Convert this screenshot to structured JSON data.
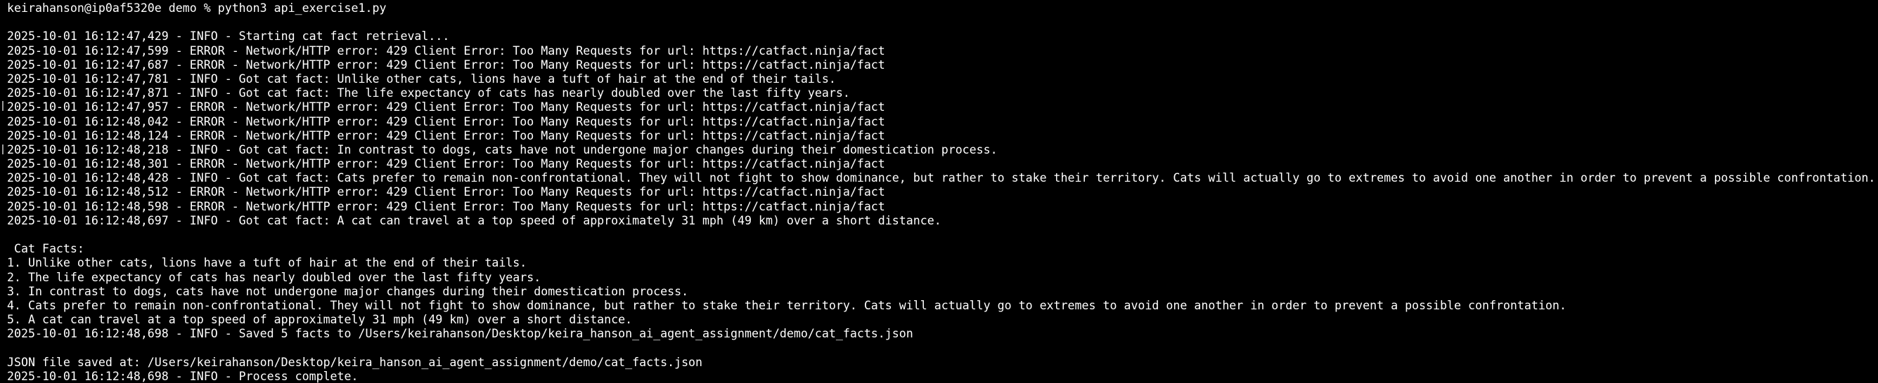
{
  "colors": {
    "background": "#000000",
    "text": "#ffffff"
  },
  "terminal": {
    "prompt": "keirahanson@ip0af5320e demo % python3 api_exercise1.py",
    "log_lines": [
      "2025-10-01 16:12:47,429 - INFO - Starting cat fact retrieval...",
      "2025-10-01 16:12:47,599 - ERROR - Network/HTTP error: 429 Client Error: Too Many Requests for url: https://catfact.ninja/fact",
      "2025-10-01 16:12:47,687 - ERROR - Network/HTTP error: 429 Client Error: Too Many Requests for url: https://catfact.ninja/fact",
      "2025-10-01 16:12:47,781 - INFO - Got cat fact: Unlike other cats, lions have a tuft of hair at the end of their tails.",
      "2025-10-01 16:12:47,871 - INFO - Got cat fact: The life expectancy of cats has nearly doubled over the last fifty years.",
      "2025-10-01 16:12:47,957 - ERROR - Network/HTTP error: 429 Client Error: Too Many Requests for url: https://catfact.ninja/fact",
      "2025-10-01 16:12:48,042 - ERROR - Network/HTTP error: 429 Client Error: Too Many Requests for url: https://catfact.ninja/fact",
      "2025-10-01 16:12:48,124 - ERROR - Network/HTTP error: 429 Client Error: Too Many Requests for url: https://catfact.ninja/fact",
      "2025-10-01 16:12:48,218 - INFO - Got cat fact: In contrast to dogs, cats have not undergone major changes during their domestication process.",
      "2025-10-01 16:12:48,301 - ERROR - Network/HTTP error: 429 Client Error: Too Many Requests for url: https://catfact.ninja/fact",
      "2025-10-01 16:12:48,428 - INFO - Got cat fact: Cats prefer to remain non-confrontational. They will not fight to show dominance, but rather to stake their territory. Cats will actually go to extremes to avoid one another in order to prevent a possible confrontation.",
      "2025-10-01 16:12:48,512 - ERROR - Network/HTTP error: 429 Client Error: Too Many Requests for url: https://catfact.ninja/fact",
      "2025-10-01 16:12:48,598 - ERROR - Network/HTTP error: 429 Client Error: Too Many Requests for url: https://catfact.ninja/fact",
      "2025-10-01 16:12:48,697 - INFO - Got cat fact: A cat can travel at a top speed of approximately 31 mph (49 km) over a short distance."
    ],
    "facts_header": " Cat Facts:",
    "facts": [
      "1. Unlike other cats, lions have a tuft of hair at the end of their tails.",
      "2. The life expectancy of cats has nearly doubled over the last fifty years.",
      "3. In contrast to dogs, cats have not undergone major changes during their domestication process.",
      "4. Cats prefer to remain non-confrontational. They will not fight to show dominance, but rather to stake their territory. Cats will actually go to extremes to avoid one another in order to prevent a possible confrontation.",
      "5. A cat can travel at a top speed of approximately 31 mph (49 km) over a short distance."
    ],
    "saved_log": "2025-10-01 16:12:48,698 - INFO - Saved 5 facts to /Users/keirahanson/Desktop/keira_hanson_ai_agent_assignment/demo/cat_facts.json",
    "json_saved": "JSON file saved at: /Users/keirahanson/Desktop/keira_hanson_ai_agent_assignment/demo/cat_facts.json",
    "complete_log": "2025-10-01 16:12:48,698 - INFO - Process complete."
  }
}
